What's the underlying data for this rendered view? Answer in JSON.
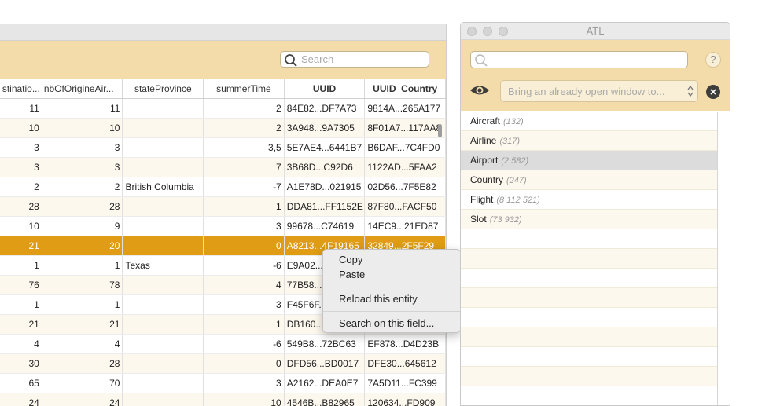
{
  "main_window": {
    "search": {
      "placeholder": "Search",
      "value": ""
    },
    "table": {
      "columns": [
        "stinatio...",
        "nbOfOrigineAir...",
        "stateProvince",
        "summerTime",
        "UUID",
        "UUID_Country"
      ],
      "rows": [
        [
          "11",
          "11",
          "",
          "2",
          "84E82...DF7A73",
          "9814A...265A177"
        ],
        [
          "10",
          "10",
          "",
          "2",
          "3A948...9A7305",
          "8F01A7...117AA8"
        ],
        [
          "3",
          "3",
          "",
          "3,5",
          "5E7AE4...6441B7",
          "B6DAF...7C4FD0"
        ],
        [
          "3",
          "3",
          "",
          "7",
          "3B68D...C92D6",
          "1122AD...5FAA2"
        ],
        [
          "2",
          "2",
          "British Columbia",
          "-7",
          "A1E78D...021915",
          "02D56...7F5E82"
        ],
        [
          "28",
          "28",
          "",
          "1",
          "DDA81...FF1152E",
          "87F80...FACF50"
        ],
        [
          "10",
          "9",
          "",
          "3",
          "99678...C74619",
          "14EC9...21ED87"
        ],
        [
          "21",
          "20",
          "",
          "0",
          "A8213...4F19165",
          "32849...2F5F29"
        ],
        [
          "1",
          "1",
          "Texas",
          "-6",
          "E9A02...4",
          ""
        ],
        [
          "76",
          "78",
          "",
          "4",
          "77B58...E4",
          ""
        ],
        [
          "1",
          "1",
          "",
          "3",
          "F45F6F...5",
          ""
        ],
        [
          "21",
          "21",
          "",
          "1",
          "DB160...1A",
          ""
        ],
        [
          "4",
          "4",
          "",
          "-6",
          "549B8...72BC63",
          "EF878...D4D23B"
        ],
        [
          "30",
          "28",
          "",
          "0",
          "DFD56...BD0017",
          "DFE30...645612"
        ],
        [
          "65",
          "70",
          "",
          "3",
          "A2162...DEA0E7",
          "7A5D11...FC399"
        ],
        [
          "24",
          "24",
          "",
          "10",
          "4546B...B82965",
          "120634...FD909"
        ]
      ]
    }
  },
  "context_menu": {
    "copy": "Copy",
    "paste": "Paste",
    "reload": "Reload this entity",
    "search_field": "Search on this field..."
  },
  "atl_window": {
    "title": "ATL",
    "search": {
      "placeholder": "",
      "value": ""
    },
    "help_label": "?",
    "window_select_placeholder": "Bring an already open window to...",
    "entities": [
      {
        "name": "Aircraft",
        "count": "(132)"
      },
      {
        "name": "Airline",
        "count": "(317)"
      },
      {
        "name": "Airport",
        "count": "(2 582)"
      },
      {
        "name": "Country",
        "count": "(247)"
      },
      {
        "name": "Flight",
        "count": "(8 112 521)"
      },
      {
        "name": "Slot",
        "count": "(73 932)"
      }
    ],
    "highlighted_entity": "Airport"
  },
  "colors": {
    "toolbar": "#f4dcaa",
    "selection": "#df9c14",
    "row_alt": "#fdf8ee"
  },
  "icons": [
    "search-icon",
    "eye-icon",
    "chevron-updown-icon",
    "close-icon",
    "help-icon"
  ]
}
